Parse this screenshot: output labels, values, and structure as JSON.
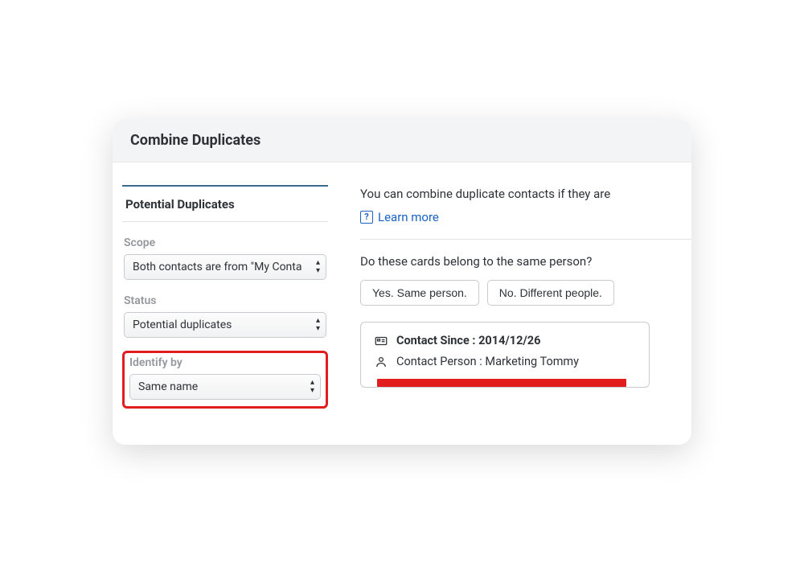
{
  "header": {
    "title": "Combine Duplicates"
  },
  "left": {
    "tab_label": "Potential Duplicates",
    "scope": {
      "label": "Scope",
      "value": "Both contacts are from \"My Conta"
    },
    "status": {
      "label": "Status",
      "value": "Potential duplicates"
    },
    "identify": {
      "label": "Identify by",
      "value": "Same name"
    }
  },
  "right": {
    "instruction": "You can combine duplicate contacts if they are",
    "learn_more": "Learn more",
    "question": "Do these cards belong to the same person?",
    "yes_label": "Yes. Same person.",
    "no_label": "No. Different people.",
    "contact_since_label": "Contact Since : ",
    "contact_since_value": "2014/12/26",
    "contact_person_label": "Contact Person : ",
    "contact_person_value": "Marketing Tommy"
  }
}
